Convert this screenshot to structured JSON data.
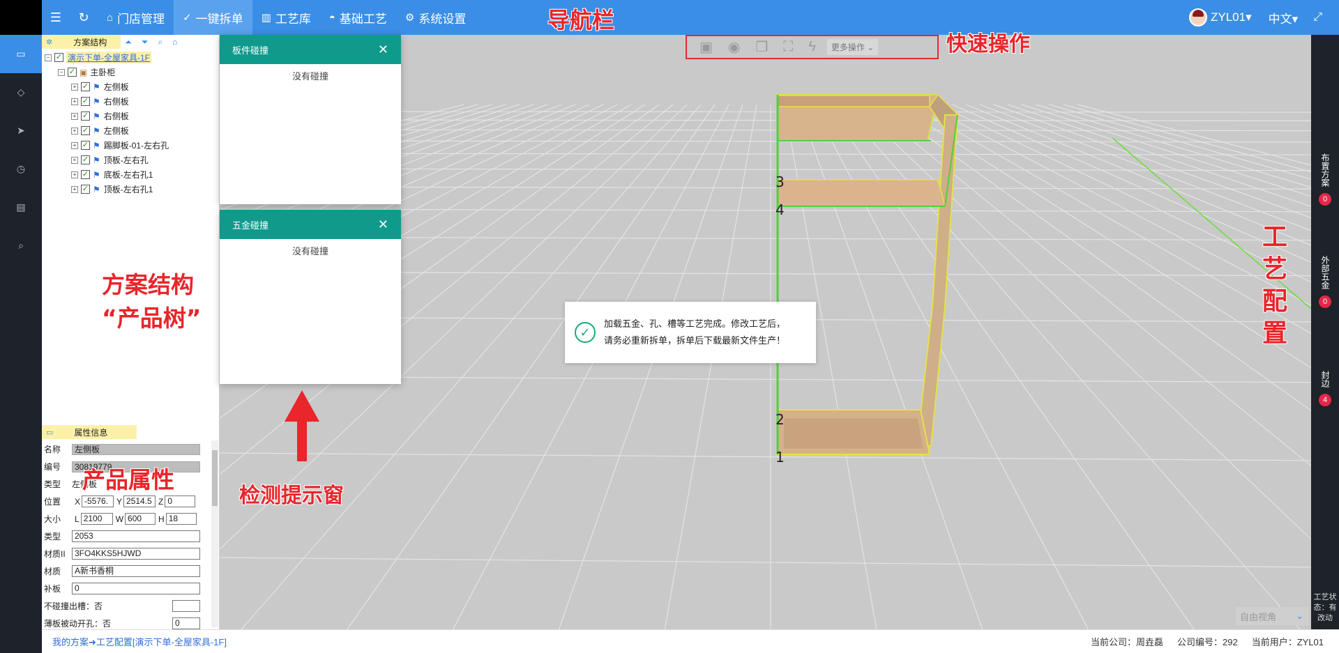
{
  "topnav": {
    "items": [
      {
        "label": "门店管理",
        "icon": "home-icon"
      },
      {
        "label": "一键拆单",
        "icon": "shield-check-icon"
      },
      {
        "label": "工艺库",
        "icon": "book-icon"
      },
      {
        "label": "基础工艺",
        "icon": "palette-icon"
      },
      {
        "label": "系统设置",
        "icon": "gear-icon"
      }
    ],
    "user": "ZYL01",
    "language": "中文"
  },
  "annotations": {
    "nav": "导航栏",
    "quick": "快速操作",
    "tree": "方案结构",
    "tree2": "“产品树”",
    "props": "产品属性",
    "detect": "检测提示窗",
    "craft": [
      "工",
      "艺",
      "配",
      "置"
    ]
  },
  "tree_panel": {
    "title": "方案结构",
    "root": "演示下单-全屋家具-1F",
    "group": "主卧柜",
    "items": [
      "左侧板",
      "右侧板",
      "右侧板",
      "左侧板",
      "踢脚板-01-左右孔",
      "顶板-左右孔",
      "底板-左右孔1",
      "顶板-左右孔1"
    ]
  },
  "props_panel": {
    "title": "属性信息",
    "name_label": "名称",
    "name": "左侧板",
    "code_label": "编号",
    "code": "30819779",
    "type_label": "类型",
    "type": "左侧板",
    "pos_label": "位置",
    "x": "-5576.",
    "y": "2514.5",
    "z": "0",
    "size_label": "大小",
    "l": "2100",
    "w": "600",
    "h": "18",
    "type2_label": "类型",
    "type2": "2053",
    "mat_id_label": "材质II",
    "mat_id": "3FO4KKS5HJWD",
    "mat_label": "材质",
    "mat": "A新书香桐",
    "patch_label": "补板",
    "patch": "0",
    "nocollide_label": "不碰撞出槽：否",
    "thin_label": "薄板被动开孔：否",
    "thin": "0"
  },
  "popups": {
    "board": {
      "title": "板件碰撞",
      "body": "没有碰撞"
    },
    "hardware": {
      "title": "五金碰撞",
      "body": "没有碰撞"
    }
  },
  "quickbar": {
    "more": "更多操作"
  },
  "toast": {
    "line1": "加载五金、孔、槽等工艺完成。修改工艺后，",
    "line2": "请务必重新拆单，拆单后下载最新文件生产！"
  },
  "markers": [
    "3",
    "4",
    "2",
    "1"
  ],
  "right_rail": {
    "layout": "布置方案",
    "layout_count": "0",
    "hardware": "外部五金",
    "hardware_count": "0",
    "edge": "封边",
    "edge_count": "4",
    "status": [
      "工艺状",
      "态：有",
      "改动"
    ]
  },
  "view_select": "自由视角",
  "statusbar": {
    "breadcrumb": "我的方案➜工艺配置[演示下单-全屋家具-1F]",
    "company": "当前公司：周垚磊",
    "company_no": "公司编号：292",
    "user": "当前用户：ZYL01"
  }
}
